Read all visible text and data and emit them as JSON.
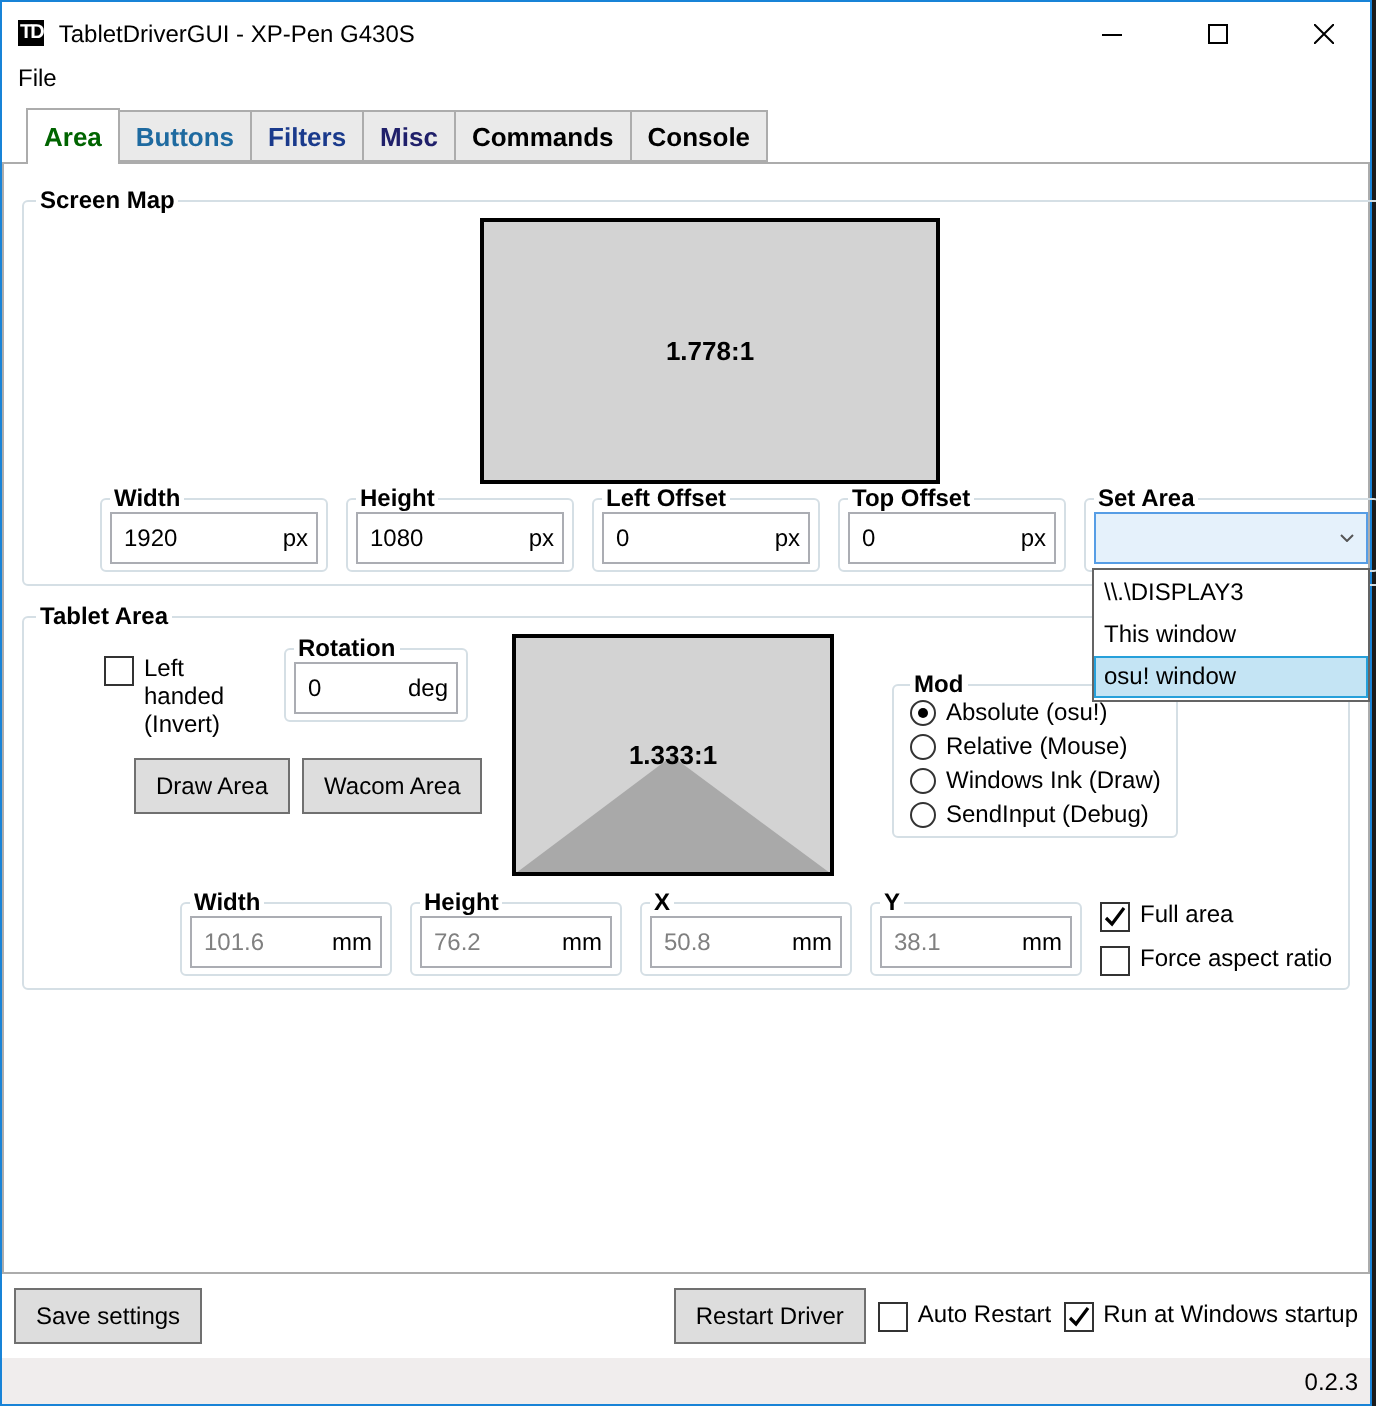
{
  "window": {
    "icon_text": "TD",
    "title": "TabletDriverGUI - XP-Pen G430S"
  },
  "menu": [
    "File"
  ],
  "tabs": [
    {
      "label": "Area",
      "selected": true,
      "color": "#006400"
    },
    {
      "label": "Buttons",
      "selected": false,
      "color": "#1e6aa0"
    },
    {
      "label": "Filters",
      "selected": false,
      "color": "#1a3a8c"
    },
    {
      "label": "Misc",
      "selected": false,
      "color": "#20206a"
    },
    {
      "label": "Commands",
      "selected": false,
      "color": "#000000"
    },
    {
      "label": "Console",
      "selected": false,
      "color": "#000000"
    }
  ],
  "screen_map": {
    "title": "Screen Map",
    "ratio": "1.778:1",
    "fields": [
      {
        "label": "Width",
        "value": "1920",
        "unit": "px"
      },
      {
        "label": "Height",
        "value": "1080",
        "unit": "px"
      },
      {
        "label": "Left Offset",
        "value": "0",
        "unit": "px"
      },
      {
        "label": "Top Offset",
        "value": "0",
        "unit": "px"
      }
    ],
    "set_area": {
      "label": "Set Area",
      "expanded": true,
      "options": [
        {
          "label": "\\\\.\\DISPLAY3",
          "selected": false
        },
        {
          "label": "This window",
          "selected": false
        },
        {
          "label": "osu! window",
          "selected": true
        }
      ]
    }
  },
  "tablet_area": {
    "title": "Tablet Area",
    "left_handed": {
      "label": "Left handed (Invert)",
      "checked": false
    },
    "rotation": {
      "label": "Rotation",
      "value": "0",
      "unit": "deg"
    },
    "buttons": [
      "Draw Area",
      "Wacom Area"
    ],
    "ratio": "1.333:1",
    "mode": {
      "title": "Mod",
      "options": [
        {
          "label": "Absolute (osu!)",
          "selected": true
        },
        {
          "label": "Relative (Mouse)",
          "selected": false
        },
        {
          "label": "Windows Ink (Draw)",
          "selected": false
        },
        {
          "label": "SendInput (Debug)",
          "selected": false
        }
      ]
    },
    "fields": [
      {
        "label": "Width",
        "value": "101.6",
        "unit": "mm",
        "disabled": true
      },
      {
        "label": "Height",
        "value": "76.2",
        "unit": "mm",
        "disabled": true
      },
      {
        "label": "X",
        "value": "50.8",
        "unit": "mm",
        "disabled": true
      },
      {
        "label": "Y",
        "value": "38.1",
        "unit": "mm",
        "disabled": true
      }
    ],
    "options": [
      {
        "label": "Full area",
        "checked": true
      },
      {
        "label": "Force aspect ratio",
        "checked": false
      }
    ]
  },
  "footer": {
    "save": "Save settings",
    "restart": "Restart Driver",
    "checks": [
      {
        "label": "Auto Restart",
        "checked": false
      },
      {
        "label": "Run at Windows startup",
        "checked": true
      }
    ]
  },
  "status_bar": {
    "version": "0.2.3"
  }
}
